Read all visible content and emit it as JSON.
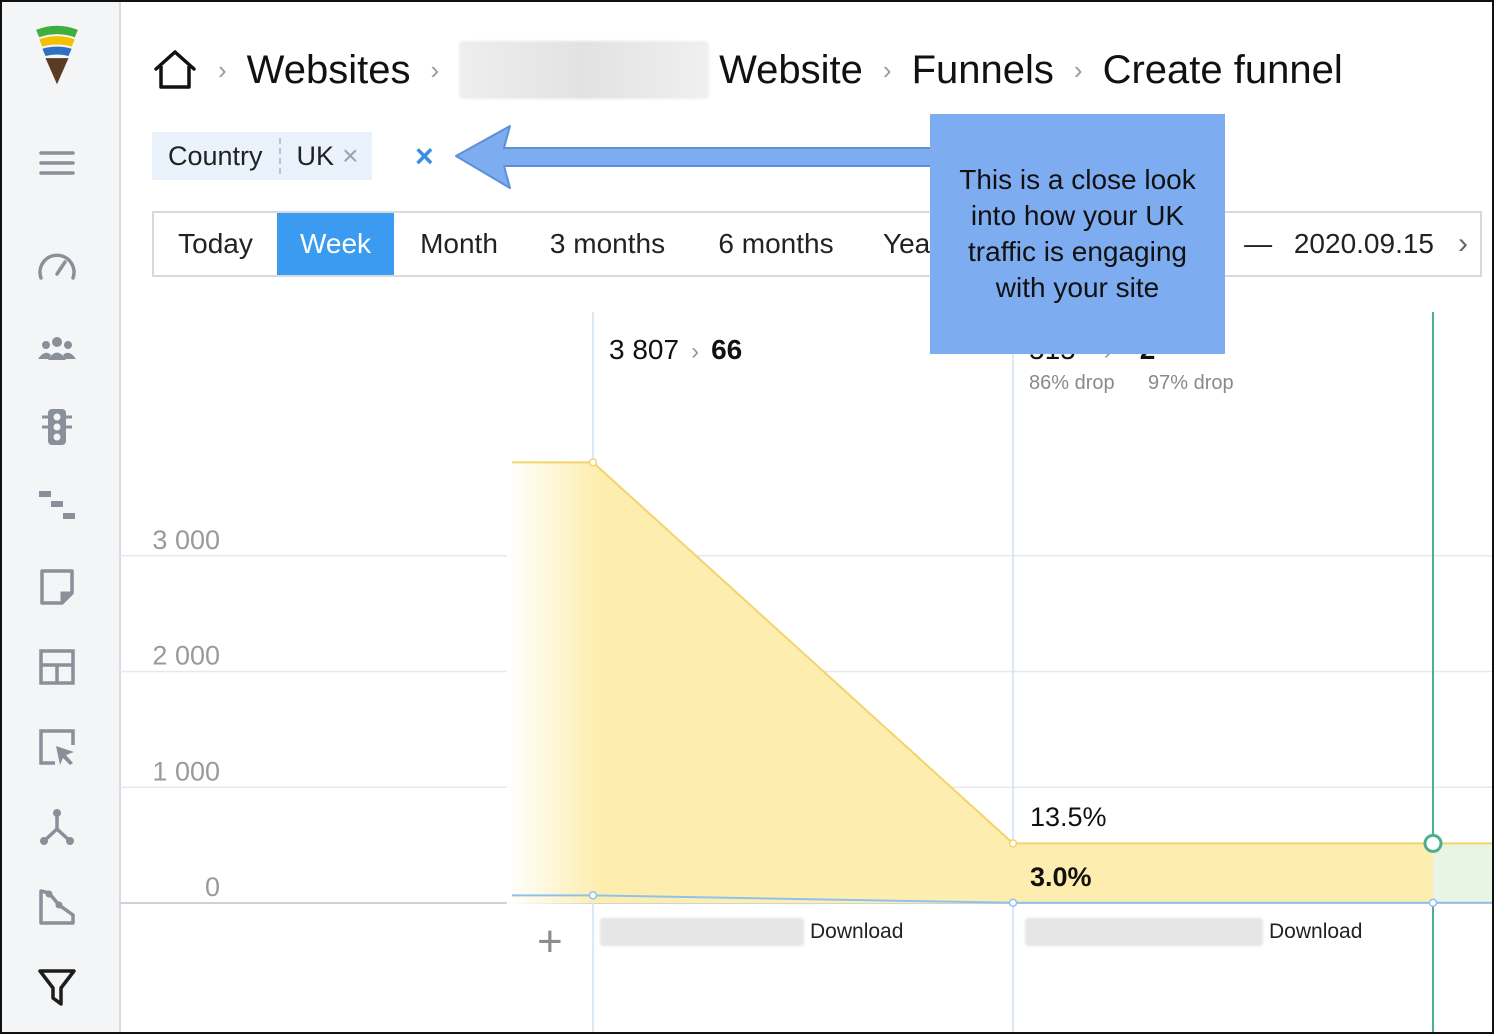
{
  "breadcrumb": {
    "items": [
      "Websites",
      "Website",
      "Funnels",
      "Create funnel"
    ]
  },
  "filter": {
    "key": "Country",
    "value": "UK",
    "remove_symbol": "×",
    "clear_symbol": "×"
  },
  "periods": {
    "tabs": [
      "Today",
      "Week",
      "Month",
      "3 months",
      "6 months",
      "Yea"
    ],
    "active": "Week",
    "range_end_fragment": "9",
    "range_dash": "—",
    "range_end": "2020.09.15",
    "next_symbol": "›"
  },
  "callout": {
    "text": "This is a close look into how your UK traffic is engaging with your site"
  },
  "chart_data": {
    "type": "area",
    "ylim": [
      0,
      3750
    ],
    "yticks": [
      "0",
      "1 000",
      "2 000",
      "3 000"
    ],
    "series": [
      {
        "values": [
          3807,
          515,
          515
        ]
      },
      {
        "values": [
          66,
          2,
          2
        ]
      }
    ],
    "steps": [
      {
        "total": "3 807",
        "converted": "66",
        "step_label": "Download"
      },
      {
        "total": "515",
        "converted": "2",
        "total_drop": "86% drop",
        "converted_drop": "97% drop",
        "conversion_total": "13.5%",
        "conversion_converted": "3.0%",
        "step_label": "Download"
      }
    ]
  },
  "sidebar": {
    "icons": [
      "logo-icon",
      "menu-icon",
      "dashboard-icon",
      "visitors-icon",
      "traffic-icon",
      "funnels-steps-icon",
      "notes-icon",
      "layout-icon",
      "click-icon",
      "network-icon",
      "trend-icon",
      "funnel-icon"
    ]
  },
  "colors": {
    "active_tab": "#3b9bf0",
    "callout_bg": "#7eacf0",
    "area_fill": "#fdeeb0",
    "area_line": "#f3d46a",
    "converted_line": "#8fc1ec",
    "goal_line": "#4caf8e",
    "filter_clear": "#3a8fe0"
  }
}
